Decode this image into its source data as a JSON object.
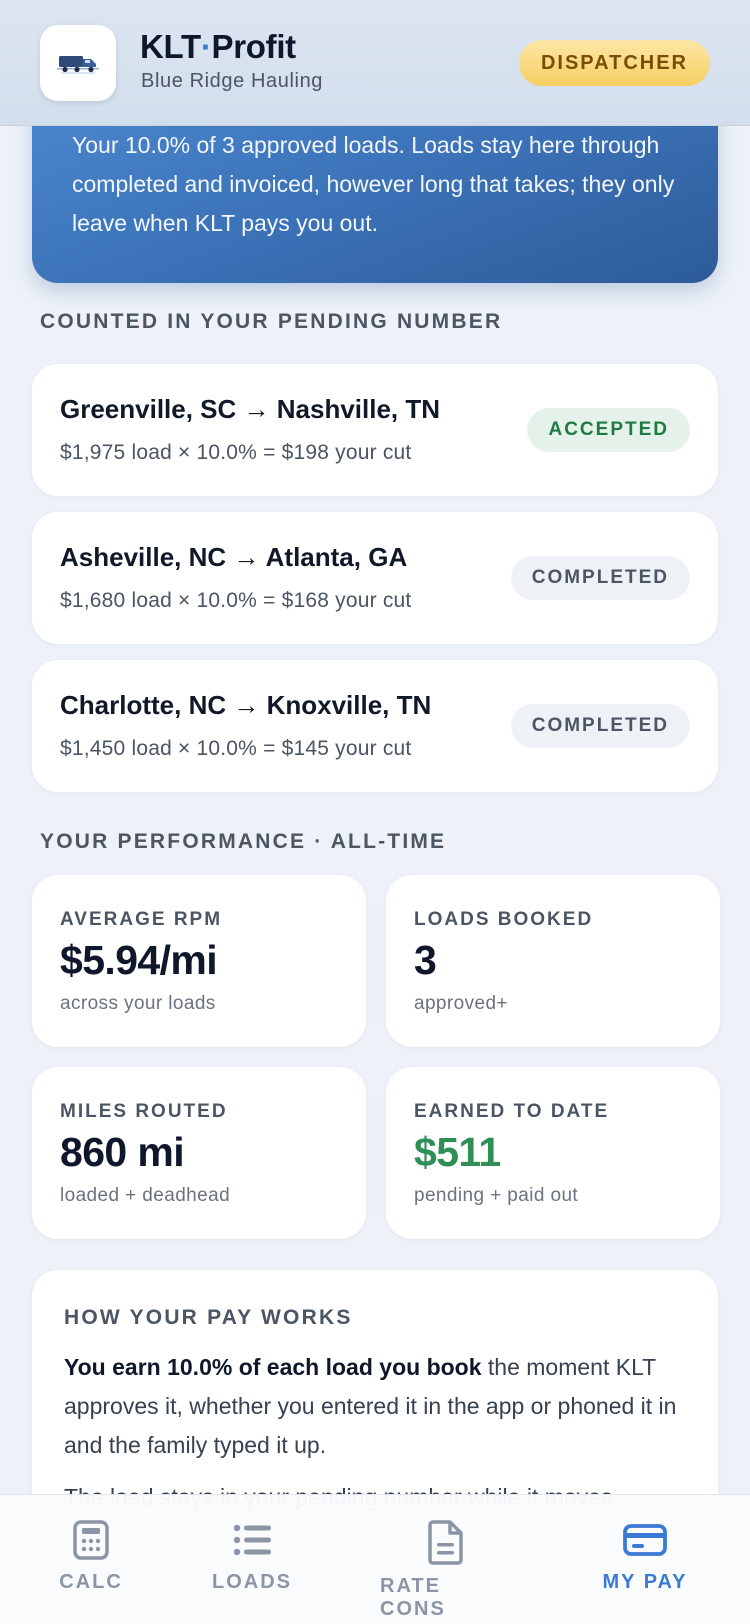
{
  "header": {
    "brand_main": "KLT",
    "brand_dot": "·",
    "brand_suffix": "Profit",
    "company": "Blue Ridge Hauling",
    "role_badge": "DISPATCHER",
    "logo_icon": "truck-logo-icon"
  },
  "banner": {
    "text": "Your 10.0% of 3 approved loads. Loads stay here through completed and invoiced, however long that takes; they only leave when KLT pays you out."
  },
  "pending_section": {
    "title": "COUNTED IN YOUR PENDING NUMBER",
    "loads": [
      {
        "route": "Greenville, SC → Nashville, TN",
        "calc": "$1,975 load × 10.0% = $198 your cut",
        "status": "ACCEPTED"
      },
      {
        "route": "Asheville, NC → Atlanta, GA",
        "calc": "$1,680 load × 10.0% = $168 your cut",
        "status": "COMPLETED"
      },
      {
        "route": "Charlotte, NC → Knoxville, TN",
        "calc": "$1,450 load × 10.0% = $145 your cut",
        "status": "COMPLETED"
      }
    ]
  },
  "performance_section": {
    "title": "YOUR PERFORMANCE · ALL-TIME",
    "stats": [
      {
        "label": "AVERAGE RPM",
        "value": "$5.94/mi",
        "note": "across your loads"
      },
      {
        "label": "LOADS BOOKED",
        "value": "3",
        "note": "approved+"
      },
      {
        "label": "MILES ROUTED",
        "value": "860 mi",
        "note": "loaded + deadhead"
      },
      {
        "label": "EARNED TO DATE",
        "value": "$511",
        "note": "pending + paid out"
      }
    ]
  },
  "how_pay": {
    "title": "HOW YOUR PAY WORKS",
    "p1_bold": "You earn 10.0% of each load you book",
    "p1_rest": " the moment KLT approves it, whether you entered it in the app or phoned it in and the family typed it up.",
    "p2": "The load stays in your pending number while it moves"
  },
  "nav": {
    "items": [
      {
        "label": "CALC",
        "icon": "calculator-icon"
      },
      {
        "label": "LOADS",
        "icon": "list-icon"
      },
      {
        "label": "RATE CONS",
        "icon": "document-icon"
      },
      {
        "label": "MY PAY",
        "icon": "credit-card-icon"
      }
    ],
    "active": "MY PAY"
  },
  "colors": {
    "accent": "#3b7bd6",
    "banner": "#3a6fb4",
    "badge": "#f6cf61",
    "accepted": "#1f7a45",
    "earned": "#2f8f57"
  }
}
